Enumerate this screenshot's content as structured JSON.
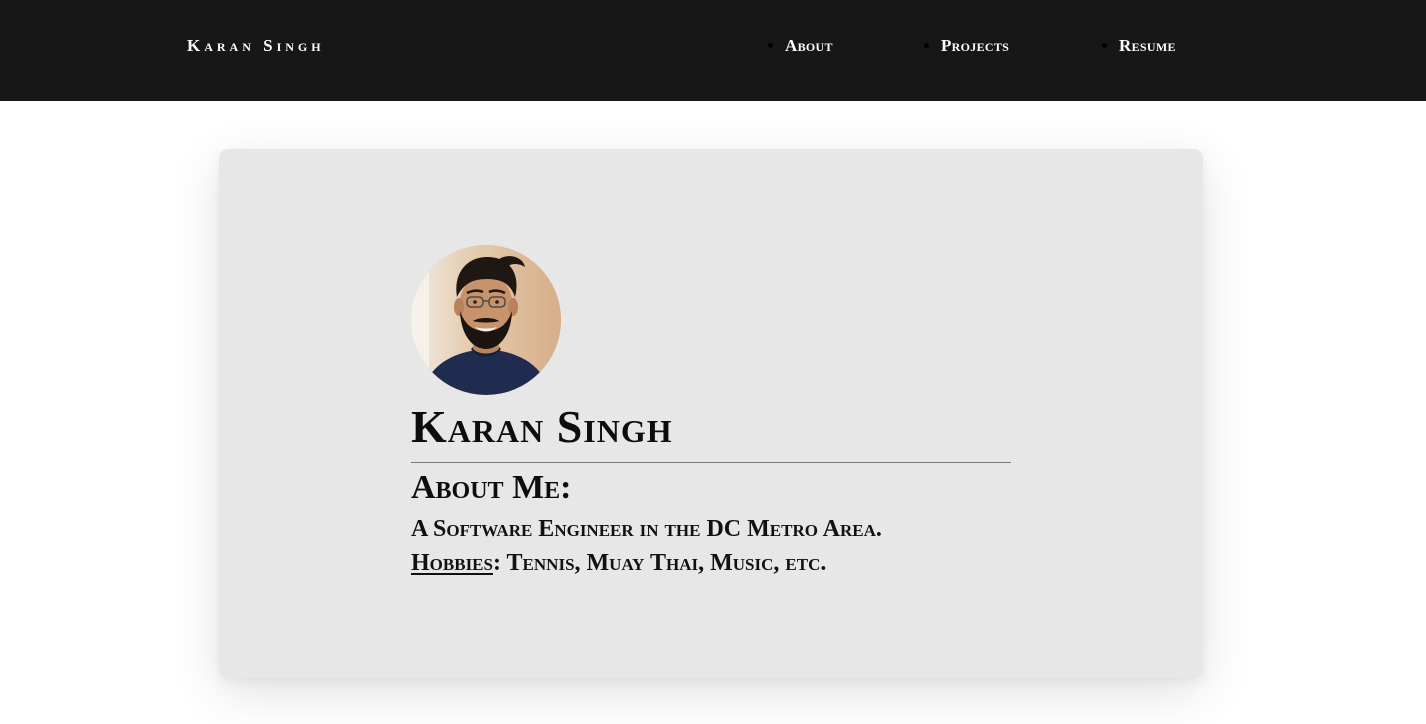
{
  "header": {
    "brand": "Karan Singh",
    "nav": [
      {
        "label": "About"
      },
      {
        "label": "Projects"
      },
      {
        "label": "Resume"
      }
    ],
    "background_color": "#171717"
  },
  "profile": {
    "name": "Karan Singh",
    "about_heading": "About Me:",
    "tagline": "A Software Engineer in the DC Metro Area.",
    "hobbies_label": "Hobbies",
    "hobbies_separator": ": ",
    "hobbies_value": "Tennis, Muay Thai, Music, etc.",
    "card_color": "#e7e7e7"
  }
}
